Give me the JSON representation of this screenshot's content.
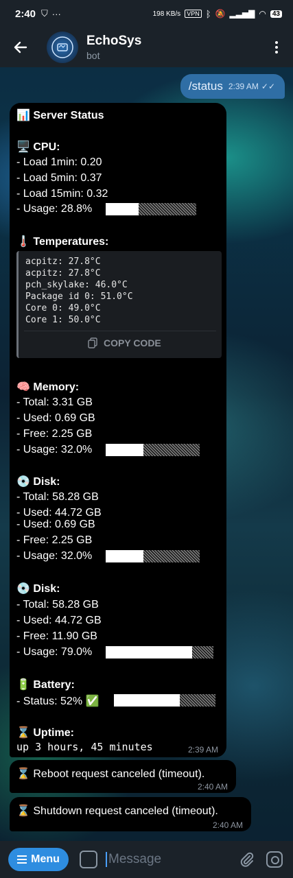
{
  "status_bar": {
    "time": "2:40",
    "speed": "198 KB/s",
    "vpn": "VPN",
    "battery": "43"
  },
  "header": {
    "title": "EchoSys",
    "subtitle": "bot"
  },
  "outgoing": {
    "text": "/status",
    "time": "2:39 AM"
  },
  "status_msg": {
    "title": "Server Status",
    "cpu": {
      "heading": "CPU:",
      "lines": [
        "- Load 1min: 0.20",
        "- Load 5min: 0.37",
        "- Load 15min: 0.32"
      ],
      "usage": "- Usage: 28.8%",
      "usage_value": 28.8
    },
    "temp": {
      "heading": "Temperatures:",
      "lines": [
        "acpitz: 27.8°C",
        "acpitz: 27.8°C",
        "pch_skylake: 46.0°C",
        "Package id 0: 51.0°C",
        "Core 0: 49.0°C",
        "Core 1: 50.0°C"
      ],
      "copy_label": "COPY CODE"
    },
    "memory": {
      "heading": "Memory:",
      "lines": [
        "- Total: 3.31 GB",
        "- Used: 0.69 GB",
        "- Free: 2.25 GB"
      ],
      "usage": "- Usage: 32.0%",
      "usage_value": 32.0
    },
    "disk1": {
      "heading": "Disk:",
      "lines": [
        "- Total: 58.28 GB",
        "- Used: 44.72 GB",
        "- Used: 0.69 GB",
        "- Free: 2.25 GB"
      ],
      "usage": "- Usage: 32.0%",
      "usage_value": 32.0
    },
    "disk2": {
      "heading": "Disk:",
      "lines": [
        "- Total: 58.28 GB",
        "- Used: 44.72 GB",
        "- Free: 11.90 GB"
      ],
      "usage": "- Usage: 79.0%",
      "usage_value": 79.0
    },
    "battery": {
      "heading": "Battery:",
      "status": "- Status: 52%",
      "check": "✅",
      "value": 52
    },
    "uptime": {
      "heading": "Uptime:",
      "text": "up 3 hours, 45 minutes"
    },
    "time": "2:39 AM"
  },
  "reboot": {
    "text": "Reboot request canceled (timeout).",
    "time": "2:40 AM"
  },
  "shutdown": {
    "text": "Shutdown request canceled (timeout).",
    "time": "2:40 AM"
  },
  "composer": {
    "menu_label": "Menu",
    "placeholder": "Message"
  }
}
